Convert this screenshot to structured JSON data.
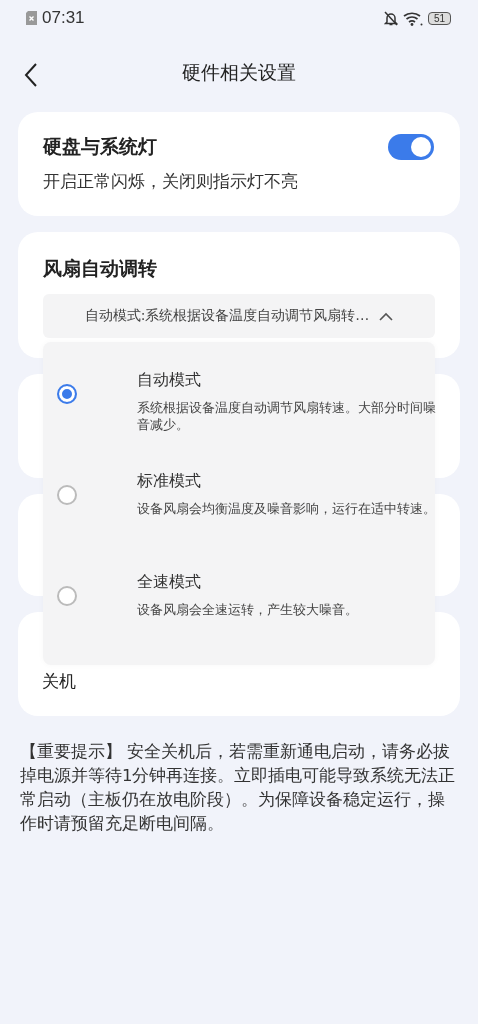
{
  "status_bar": {
    "time": "07:31",
    "battery": "51"
  },
  "header": {
    "title": "硬件相关设置"
  },
  "light_card": {
    "title": "硬盘与系统灯",
    "description": "开启正常闪烁，关闭则指示灯不亮",
    "on": true
  },
  "fan_card": {
    "title": "风扇自动调转",
    "select_value": "自动模式:系统根据设备温度自动调节风扇转…",
    "expanded": true,
    "options": [
      {
        "title": "自动模式",
        "description": "系统根据设备温度自动调节风扇转速。大部分时间噪音减少。",
        "selected": true
      },
      {
        "title": "标准模式",
        "description": "设备风扇会均衡温度及噪音影响，运行在适中转速。",
        "selected": false
      },
      {
        "title": "全速模式",
        "description": "设备风扇会全速运转，产生较大噪音。",
        "selected": false
      }
    ]
  },
  "shutdown_card": {
    "label": "关机"
  },
  "notice": "【重要提示】 安全关机后，若需重新通电启动，请务必拔掉电源并等待1分钟再连接。立即插电可能导致系统无法正常启动（主板仍在放电阶段）。为保障设备稳定运行，操作时请预留充足断电间隔。"
}
